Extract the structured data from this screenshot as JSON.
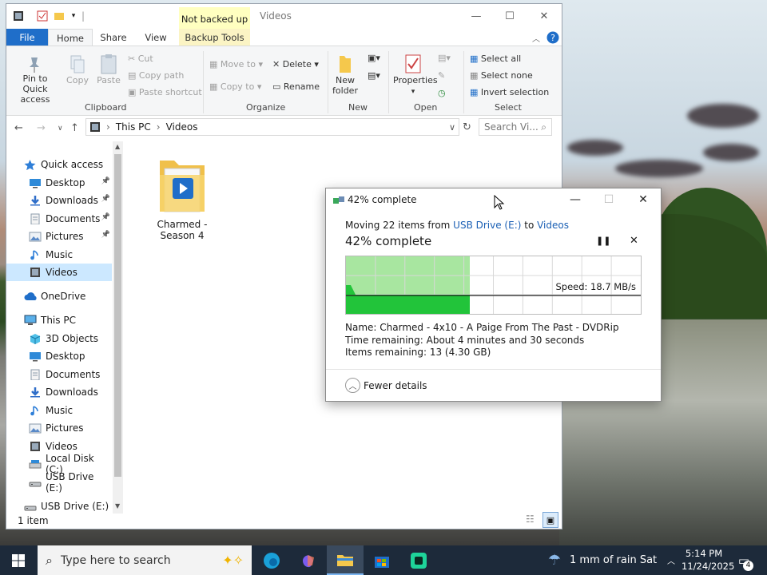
{
  "explorer": {
    "quick_access_tip": "Not backed up",
    "window_title": "Videos",
    "tabs": [
      "File",
      "Home",
      "Share",
      "View",
      "Backup Tools"
    ],
    "ribbon": {
      "clipboard": {
        "pin": "Pin to Quick access",
        "copy": "Copy",
        "paste": "Paste",
        "cut": "Cut",
        "copy_path": "Copy path",
        "paste_shortcut": "Paste shortcut",
        "label": "Clipboard"
      },
      "organize": {
        "move_to": "Move to",
        "copy_to": "Copy to",
        "delete": "Delete",
        "rename": "Rename",
        "label": "Organize"
      },
      "new": {
        "new_folder": "New folder",
        "label": "New"
      },
      "open": {
        "properties": "Properties",
        "label": "Open"
      },
      "select": {
        "select_all": "Select all",
        "select_none": "Select none",
        "invert": "Invert selection",
        "label": "Select"
      }
    },
    "address": {
      "crumb1": "This PC",
      "crumb2": "Videos",
      "search_placeholder": "Search Vi..."
    },
    "nav": [
      {
        "label": "Quick access",
        "icon": "star-icon",
        "indent": 0,
        "pinned": false
      },
      {
        "label": "Desktop",
        "icon": "desktop-icon",
        "indent": 1,
        "pinned": true
      },
      {
        "label": "Downloads",
        "icon": "download-icon",
        "indent": 1,
        "pinned": true
      },
      {
        "label": "Documents",
        "icon": "document-icon",
        "indent": 1,
        "pinned": true
      },
      {
        "label": "Pictures",
        "icon": "picture-icon",
        "indent": 1,
        "pinned": true
      },
      {
        "label": "Music",
        "icon": "music-icon",
        "indent": 1,
        "pinned": false
      },
      {
        "label": "Videos",
        "icon": "video-icon",
        "indent": 1,
        "pinned": false,
        "selected": true
      },
      {
        "label": "OneDrive",
        "icon": "cloud-icon",
        "indent": 0,
        "pinned": false
      },
      {
        "label": "This PC",
        "icon": "computer-icon",
        "indent": 0,
        "pinned": false
      },
      {
        "label": "3D Objects",
        "icon": "cube-icon",
        "indent": 1,
        "pinned": false
      },
      {
        "label": "Desktop",
        "icon": "desktop-icon",
        "indent": 1,
        "pinned": false
      },
      {
        "label": "Documents",
        "icon": "document-icon",
        "indent": 1,
        "pinned": false
      },
      {
        "label": "Downloads",
        "icon": "download-icon",
        "indent": 1,
        "pinned": false
      },
      {
        "label": "Music",
        "icon": "music-icon",
        "indent": 1,
        "pinned": false
      },
      {
        "label": "Pictures",
        "icon": "picture-icon",
        "indent": 1,
        "pinned": false
      },
      {
        "label": "Videos",
        "icon": "video-icon",
        "indent": 1,
        "pinned": false
      },
      {
        "label": "Local Disk (C:)",
        "icon": "disk-icon",
        "indent": 1,
        "pinned": false
      },
      {
        "label": "USB Drive (E:)",
        "icon": "usb-drive-icon",
        "indent": 1,
        "pinned": false
      },
      {
        "label": "USB Drive (E:)",
        "icon": "usb-drive-icon",
        "indent": 0,
        "pinned": false
      }
    ],
    "folder": {
      "name_line1": "Charmed -",
      "name_line2": "Season 4"
    },
    "status": "1 item"
  },
  "dialog": {
    "title": "42% complete",
    "moving_prefix": "Moving 22 items from ",
    "source": "USB Drive (E:)",
    "to": " to ",
    "dest": "Videos",
    "heading": "42% complete",
    "progress": 0.42,
    "speed": "Speed: 18.7 MB/s",
    "name_row": "Name:  Charmed - 4x10 - A Paige From The Past - DVDRip",
    "time_row": "Time remaining:  About 4 minutes and 30 seconds",
    "items_row": "Items remaining:  13 (4.30 GB)",
    "fewer": "Fewer details"
  },
  "taskbar": {
    "search_placeholder": "Type here to search",
    "weather": "1 mm of rain Sat",
    "time": "5:14 PM",
    "date": "11/24/2025",
    "notif_count": "4"
  },
  "colors": {
    "accent": "#1f6ec9",
    "progress_fill": "#a8e6a0",
    "progress_dark": "#22c43a",
    "selection": "#cce8ff"
  }
}
